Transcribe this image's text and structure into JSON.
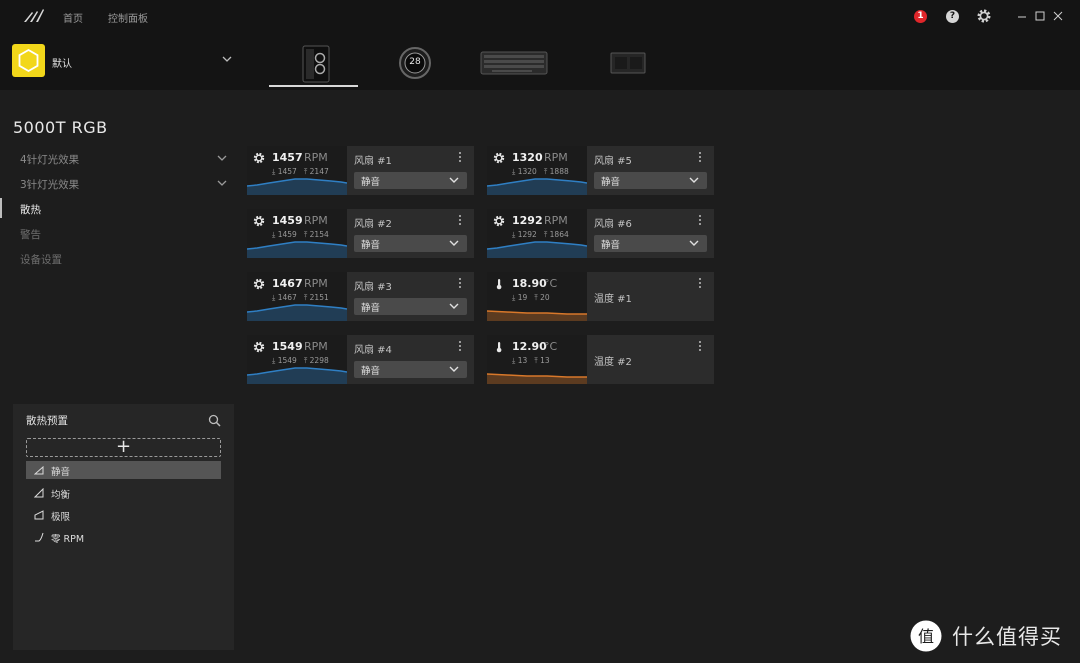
{
  "nav": {
    "home": "首页",
    "dashboard": "控制面板"
  },
  "topbar": {
    "alert_count": "1",
    "help": "?"
  },
  "profile": {
    "name": "默认",
    "accent": "#f2d71a"
  },
  "devices": [
    {
      "name": "case-device"
    },
    {
      "name": "pump-device",
      "display": "28"
    },
    {
      "name": "keyboard-device"
    },
    {
      "name": "gpu-device"
    }
  ],
  "page": {
    "title": "5000T RGB"
  },
  "sidebar": {
    "items": [
      {
        "label": "4针灯光效果"
      },
      {
        "label": "3针灯光效果"
      },
      {
        "label": "散热"
      },
      {
        "label": "警告"
      },
      {
        "label": "设备设置"
      }
    ]
  },
  "presets": {
    "title": "散热预置",
    "add": "+",
    "items": [
      {
        "label": "静音",
        "selected": true
      },
      {
        "label": "均衡"
      },
      {
        "label": "极限"
      },
      {
        "label": "零 RPM"
      }
    ]
  },
  "cards": [
    {
      "type": "fan",
      "value": "1457",
      "unit": "RPM",
      "min": "1457",
      "max": "2147",
      "name": "风扇 #1",
      "mode": "静音"
    },
    {
      "type": "fan",
      "value": "1459",
      "unit": "RPM",
      "min": "1459",
      "max": "2154",
      "name": "风扇 #2",
      "mode": "静音"
    },
    {
      "type": "fan",
      "value": "1467",
      "unit": "RPM",
      "min": "1467",
      "max": "2151",
      "name": "风扇 #3",
      "mode": "静音"
    },
    {
      "type": "fan",
      "value": "1549",
      "unit": "RPM",
      "min": "1549",
      "max": "2298",
      "name": "风扇 #4",
      "mode": "静音"
    },
    {
      "type": "fan",
      "value": "1320",
      "unit": "RPM",
      "min": "1320",
      "max": "1888",
      "name": "风扇 #5",
      "mode": "静音"
    },
    {
      "type": "fan",
      "value": "1292",
      "unit": "RPM",
      "min": "1292",
      "max": "1864",
      "name": "风扇 #6",
      "mode": "静音"
    },
    {
      "type": "temp",
      "value": "18.90",
      "unit": "°C",
      "min": "19",
      "max": "20",
      "name": "温度 #1"
    },
    {
      "type": "temp",
      "value": "12.90",
      "unit": "°C",
      "min": "13",
      "max": "13",
      "name": "温度 #2"
    }
  ],
  "colors": {
    "fan_graph": "#2f7fc4",
    "temp_graph": "#d8782a"
  },
  "watermark": {
    "text": "什么值得买",
    "icon_glyph": "值"
  }
}
